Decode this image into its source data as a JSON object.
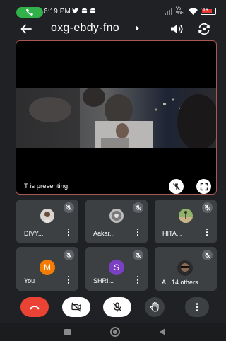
{
  "status_bar": {
    "time": "6:19 PM",
    "notifications": [
      "twitter-bird-icon",
      "android-icon",
      "android-icon"
    ],
    "network": "Vo WiFi",
    "battery": "16"
  },
  "app_bar": {
    "meeting_code": "oxg-ebdy-fno",
    "icons": [
      "back-arrow-icon",
      "caret-right-icon",
      "speaker-icon",
      "switch-camera-icon"
    ]
  },
  "presentation": {
    "label": "T is presenting",
    "highlight_color": "#a9594f"
  },
  "participants": [
    {
      "name": "DIVY...",
      "muted": true,
      "avatar": "photo"
    },
    {
      "name": "Aakar...",
      "muted": true,
      "avatar": "photo"
    },
    {
      "name": "HITA...",
      "muted": true,
      "avatar": "photo"
    },
    {
      "name": "You",
      "muted": true,
      "avatar_letter": "M",
      "avatar_color": "#f57c00"
    },
    {
      "name": "SHRI...",
      "muted": true,
      "avatar_letter": "S",
      "avatar_color": "#7b3fc4"
    },
    {
      "name": "A",
      "overlay": "14 others",
      "muted": true,
      "avatar": "photo"
    }
  ],
  "controls": {
    "end_call_color": "#ea4335",
    "items": [
      "end-call-icon",
      "camera-off-icon",
      "mic-off-icon",
      "raise-hand-icon",
      "more-options-icon"
    ]
  },
  "colors": {
    "background": "#202124",
    "tile": "#3c4043",
    "mute_badge": "#5f6368"
  }
}
